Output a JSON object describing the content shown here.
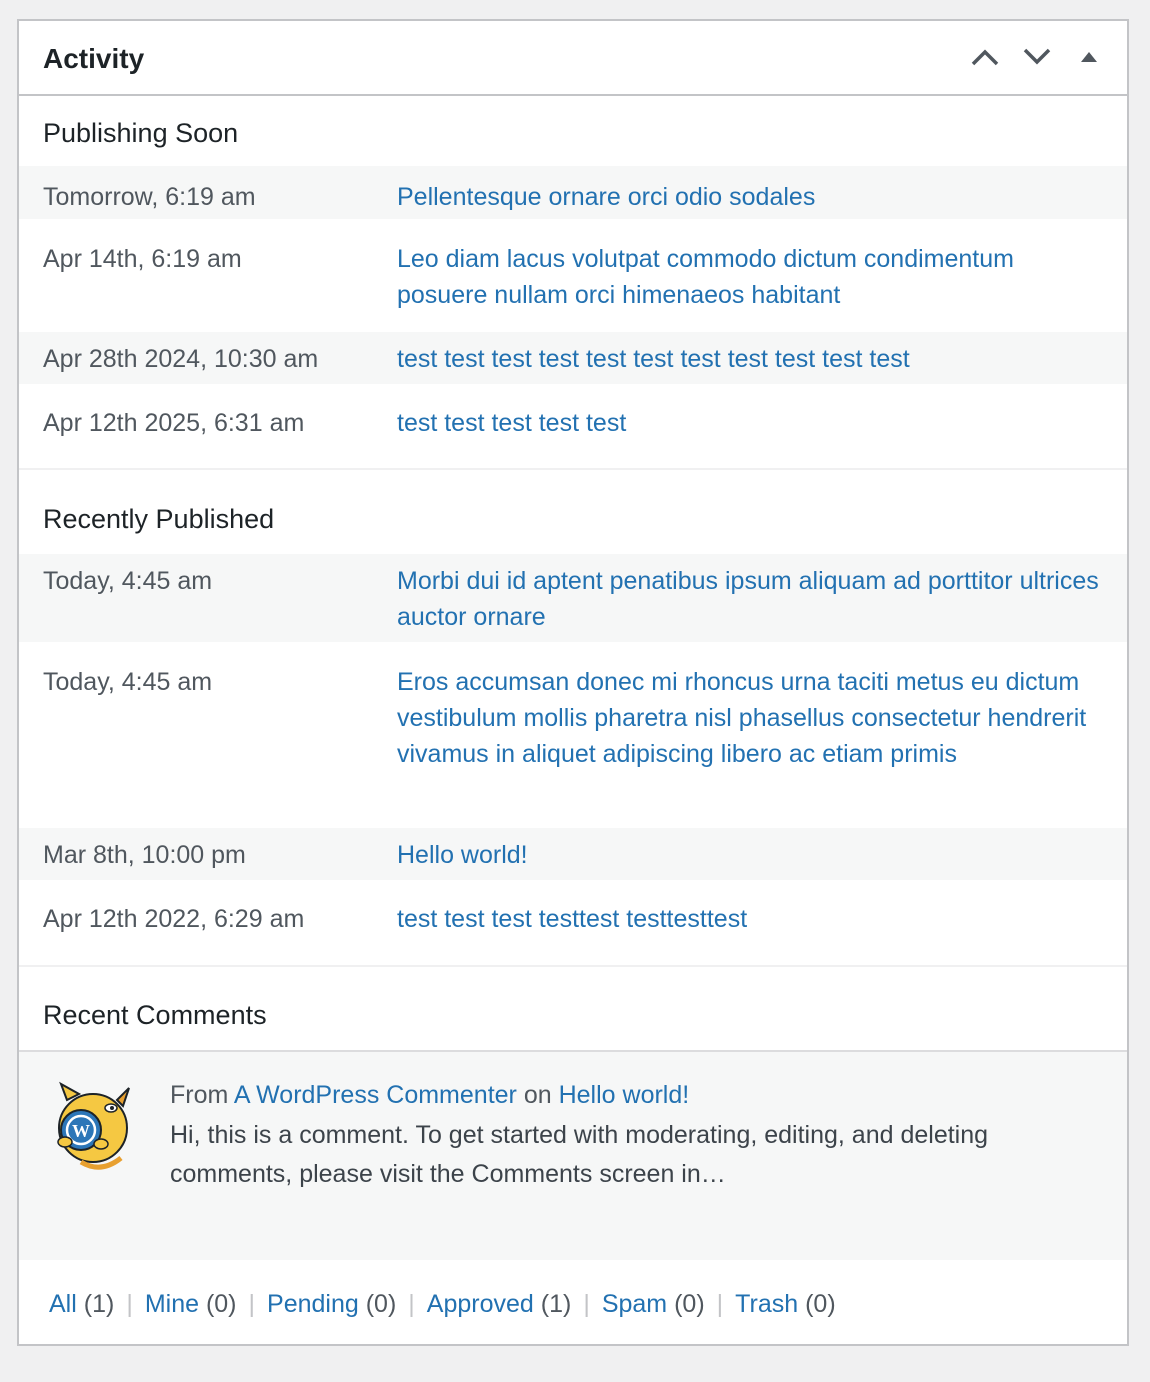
{
  "widget": {
    "title": "Activity",
    "actions": [
      "move-up",
      "move-down",
      "toggle-panel"
    ]
  },
  "publishing_soon": {
    "title": "Publishing Soon",
    "posts": [
      {
        "date": "Tomorrow, 6:19 am",
        "title": "Pellentesque ornare orci odio sodales"
      },
      {
        "date": "Apr 14th, 6:19 am",
        "title": "Leo diam lacus volutpat commodo dictum condimentum posuere nullam orci himenaeos habitant"
      },
      {
        "date": "Apr 28th 2024, 10:30 am",
        "title": "test test test test test test test test test test test"
      },
      {
        "date": "Apr 12th 2025, 6:31 am",
        "title": "test test test test test"
      }
    ]
  },
  "recently_published": {
    "title": "Recently Published",
    "posts": [
      {
        "date": "Today, 4:45 am",
        "title": "Morbi dui id aptent penatibus ipsum aliquam ad porttitor ultrices auctor ornare"
      },
      {
        "date": "Today, 4:45 am",
        "title": "Eros accumsan donec mi rhoncus urna taciti metus eu dictum vestibulum mollis pharetra nisl phasellus consectetur hendrerit vivamus in aliquet adipiscing libero ac etiam primis"
      },
      {
        "date": "Mar 8th, 10:00 pm",
        "title": "Hello world!"
      },
      {
        "date": "Apr 12th 2022, 6:29 am",
        "title": "test test test testtest testtesttest"
      }
    ]
  },
  "recent_comments": {
    "title": "Recent Comments",
    "comment": {
      "from_label": "From",
      "author": "A WordPress Commenter",
      "on_label": "on",
      "post": "Hello world!",
      "excerpt": "Hi, this is a comment. To get started with moderating, editing, and deleting comments, please visit the Comments screen in…"
    }
  },
  "filters": [
    {
      "label": "All",
      "count": "(1)"
    },
    {
      "label": "Mine",
      "count": "(0)"
    },
    {
      "label": "Pending",
      "count": "(0)"
    },
    {
      "label": "Approved",
      "count": "(1)"
    },
    {
      "label": "Spam",
      "count": "(0)"
    },
    {
      "label": "Trash",
      "count": "(0)"
    }
  ],
  "colors": {
    "link": "#2271b1",
    "alt_row": "#f6f7f7",
    "border": "#c3c4c7"
  }
}
